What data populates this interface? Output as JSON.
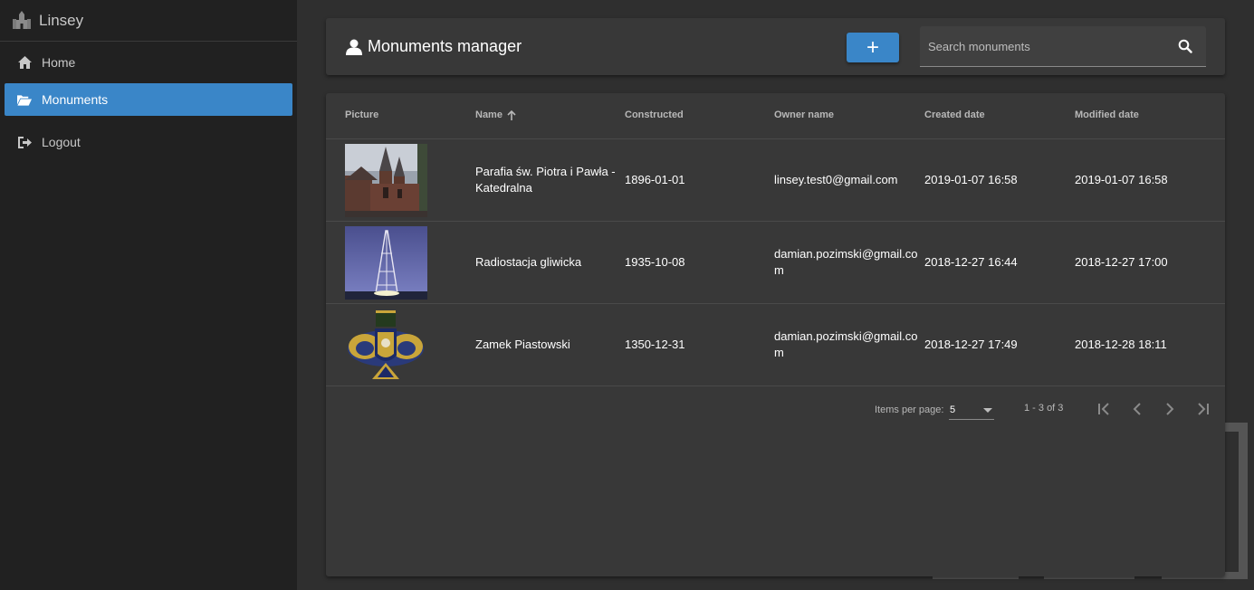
{
  "sidebar": {
    "brand": "Linsey",
    "items": [
      {
        "label": "Home",
        "icon": "home-icon"
      },
      {
        "label": "Monuments",
        "icon": "folder-open-icon",
        "active": true
      },
      {
        "label": "Logout",
        "icon": "logout-icon"
      }
    ]
  },
  "header": {
    "title": "Monuments manager",
    "add_label": "+",
    "search": {
      "placeholder": "Search monuments",
      "value": ""
    }
  },
  "table": {
    "columns": [
      "Picture",
      "Name",
      "Constructed",
      "Owner name",
      "Created date",
      "Modified date"
    ],
    "sort": {
      "column": "Name",
      "direction": "asc"
    },
    "rows": [
      {
        "picture": "church",
        "name_line1": "Parafia św. Piotra i Pawła -",
        "name_line2": "Katedralna",
        "constructed": "1896-01-01",
        "owner_line1": "linsey.test0@gmail.com",
        "owner_line2": "",
        "created": "2019-01-07 16:58",
        "modified": "2019-01-07 16:58"
      },
      {
        "picture": "radio-tower",
        "name_line1": "Radiostacja gliwicka",
        "name_line2": "",
        "constructed": "1935-10-08",
        "owner_line1": "damian.pozimski@gmail.co",
        "owner_line2": "m",
        "created": "2018-12-27 16:44",
        "modified": "2018-12-27 17:00"
      },
      {
        "picture": "coat-of-arms",
        "name_line1": "Zamek Piastowski",
        "name_line2": "",
        "constructed": "1350-12-31",
        "owner_line1": "damian.pozimski@gmail.co",
        "owner_line2": "m",
        "created": "2018-12-27 17:49",
        "modified": "2018-12-28 18:11"
      }
    ]
  },
  "paginator": {
    "items_per_page_label": "Items per page:",
    "items_per_page": "5",
    "range": "1 - 3 of 3"
  },
  "colors": {
    "accent": "#3a86c8",
    "sidebar_bg": "#212121",
    "page_bg": "#2f2f2f",
    "card_bg": "#383838"
  }
}
